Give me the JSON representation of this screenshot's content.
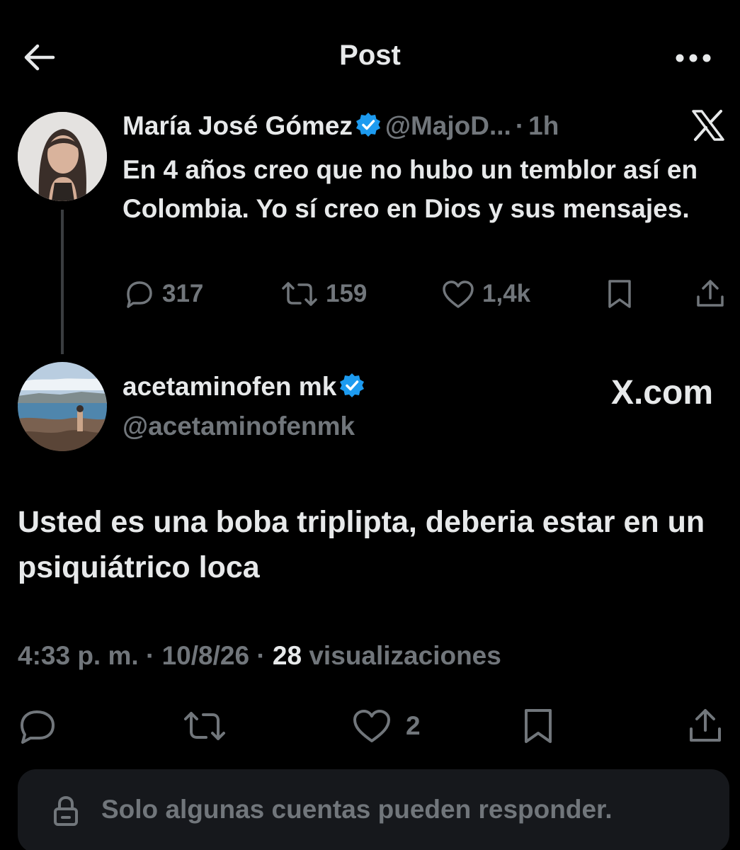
{
  "header": {
    "title": "Post",
    "back_icon": "arrow-left-icon",
    "more_icon": "more-horizontal-icon"
  },
  "parent_post": {
    "author_name": "María José Gómez",
    "handle": "@MajoD...",
    "separator": "·",
    "time": "1h",
    "text": "En 4 años creo que no hubo un temblor así en Colombia. Yo sí creo en Dios y sus mensajes.",
    "metrics": {
      "replies": "317",
      "reposts": "159",
      "likes": "1,4k"
    }
  },
  "main_post": {
    "author_name": "acetaminofen mk",
    "handle": "@acetaminofenmk",
    "watermark": "X.com",
    "text": "Usted es una boba triplipta, deberia estar en un psiquiátrico loca",
    "time": "4:33 p. m.",
    "date": "10/8/26",
    "views_count": "28",
    "views_label": "visualizaciones",
    "metrics": {
      "likes": "2"
    }
  },
  "reply_restriction": {
    "text": "Solo algunas cuentas pueden responder."
  },
  "colors": {
    "background": "#000000",
    "text_primary": "#e7e9ea",
    "text_secondary": "#71767b",
    "verified": "#1d9bf0",
    "reply_box": "#16181c"
  }
}
